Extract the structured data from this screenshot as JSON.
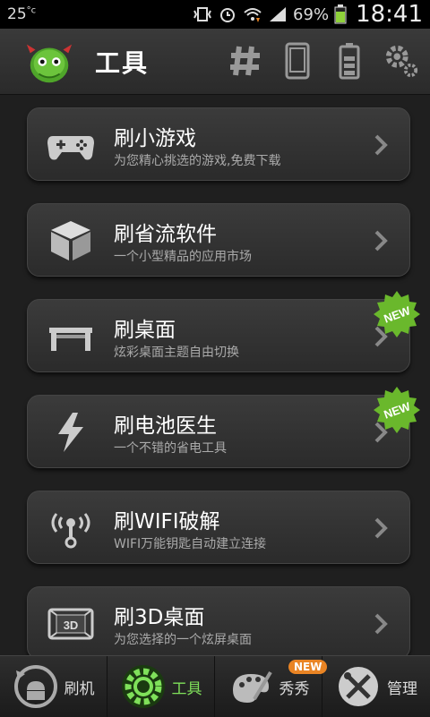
{
  "statusbar": {
    "temp": "25",
    "temp_unit": "°c",
    "battery_pct": "69%",
    "time": "18:41"
  },
  "header": {
    "title": "工具"
  },
  "items": [
    {
      "title": "刷小游戏",
      "subtitle": "为您精心挑选的游戏,免费下载",
      "icon": "gamepad-icon",
      "new": false
    },
    {
      "title": "刷省流软件",
      "subtitle": "一个小型精品的应用市场",
      "icon": "box-icon",
      "new": false
    },
    {
      "title": "刷桌面",
      "subtitle": "炫彩桌面主题自由切换",
      "icon": "table-icon",
      "new": true
    },
    {
      "title": "刷电池医生",
      "subtitle": "一个不错的省电工具",
      "icon": "lightning-icon",
      "new": true
    },
    {
      "title": "刷WIFI破解",
      "subtitle": "WIFI万能钥匙自动建立连接",
      "icon": "wifi-key-icon",
      "new": false
    },
    {
      "title": "刷3D桌面",
      "subtitle": "为您选择的一个炫屏桌面",
      "icon": "3d-icon",
      "new": false
    }
  ],
  "badge_text": "NEW",
  "bottomnav": [
    {
      "label": "刷机",
      "icon": "android-refresh-icon"
    },
    {
      "label": "工具",
      "icon": "gear-icon"
    },
    {
      "label": "秀秀",
      "icon": "palette-icon",
      "badge": "NEW"
    },
    {
      "label": "管理",
      "icon": "tools-icon"
    }
  ],
  "colors": {
    "accent": "#7fe05a",
    "badge_green": "#6ab82c",
    "badge_orange": "#e98424"
  }
}
